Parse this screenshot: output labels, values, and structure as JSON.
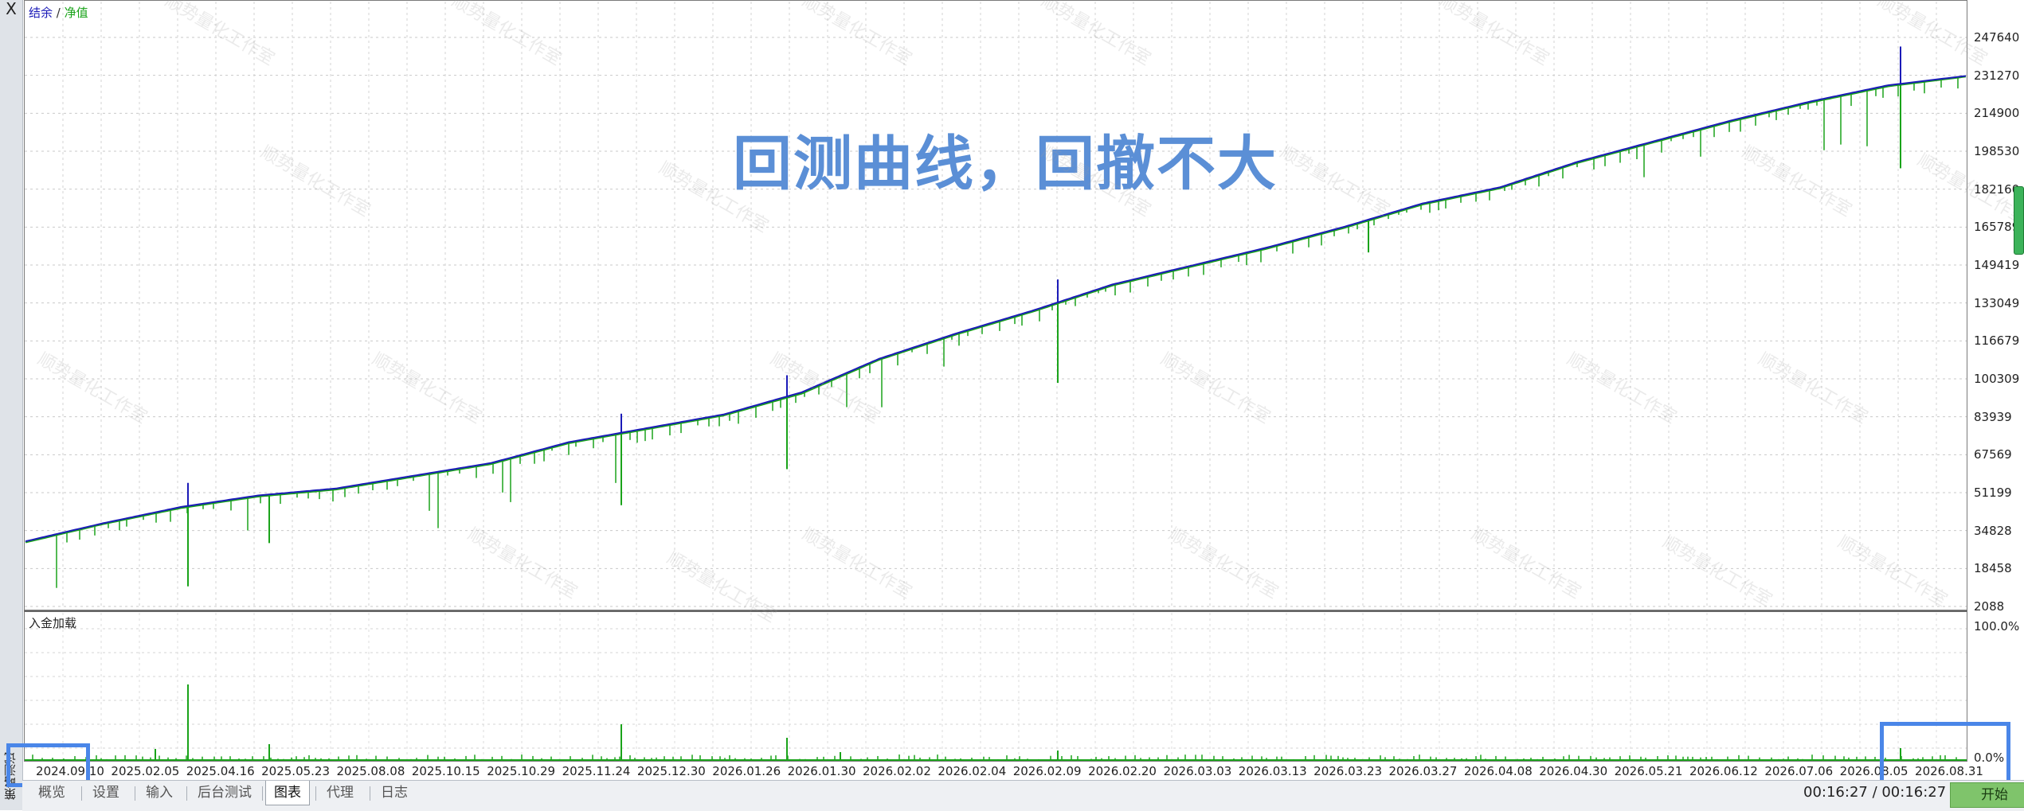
{
  "side_panel": {
    "close_glyph": "X",
    "label": "策略测试"
  },
  "legend": {
    "balance": "结余",
    "separator": "/",
    "equity": "净值"
  },
  "overlay_title": "回测曲线，回撤不大",
  "watermark_text": "顺势量化工作室",
  "sub_title": "入金加载",
  "y_axis_labels": [
    "247640",
    "231270",
    "214900",
    "198530",
    "182160",
    "165789",
    "149419",
    "133049",
    "116679",
    "100309",
    "83939",
    "67569",
    "51199",
    "34828",
    "18458",
    "2088"
  ],
  "sub_y_axis_labels": [
    "100.0%",
    "0.0%"
  ],
  "x_axis_labels": [
    "2024.09.10",
    "2025.02.05",
    "2025.04.16",
    "2025.05.23",
    "2025.08.08",
    "2025.10.15",
    "2025.10.29",
    "2025.11.24",
    "2025.12.30",
    "2026.01.26",
    "2026.01.30",
    "2026.02.02",
    "2026.02.04",
    "2026.02.09",
    "2026.02.20",
    "2026.03.03",
    "2026.03.13",
    "2026.03.23",
    "2026.03.27",
    "2026.04.08",
    "2026.04.30",
    "2026.05.21",
    "2026.06.12",
    "2026.07.06",
    "2026.08.05",
    "2026.08.31"
  ],
  "tabs": [
    {
      "label": "概览",
      "active": false
    },
    {
      "label": "设置",
      "active": false
    },
    {
      "label": "输入",
      "active": false
    },
    {
      "label": "后台测试",
      "active": false
    },
    {
      "label": "图表",
      "active": true
    },
    {
      "label": "代理",
      "active": false
    },
    {
      "label": "日志",
      "active": false
    }
  ],
  "timer": "00:16:27 / 00:16:27",
  "start_label": "开始",
  "colors": {
    "balance": "#1b1bb8",
    "equity": "#1aa31a",
    "highlight": "#4a86e8",
    "overlay": "#5b8fd6",
    "start": "#7fc46b"
  },
  "chart_data": {
    "type": "line",
    "y_range": [
      2088,
      247640
    ],
    "x_categories": [
      "2024.09.10",
      "2025.02.05",
      "2025.04.16",
      "2025.05.23",
      "2025.08.08",
      "2025.10.15",
      "2025.10.29",
      "2025.11.24",
      "2025.12.30",
      "2026.01.26",
      "2026.01.30",
      "2026.02.02",
      "2026.02.04",
      "2026.02.09",
      "2026.02.20",
      "2026.03.03",
      "2026.03.13",
      "2026.03.23",
      "2026.03.27",
      "2026.04.08",
      "2026.04.30",
      "2026.05.21",
      "2026.06.12",
      "2026.07.06",
      "2026.08.05",
      "2026.08.31"
    ],
    "series": [
      {
        "name": "结余",
        "values": [
          30200,
          38000,
          45000,
          50000,
          53000,
          58500,
          64000,
          73000,
          79000,
          85000,
          94500,
          109000,
          120000,
          130000,
          141000,
          149000,
          157000,
          166000,
          176000,
          183000,
          194000,
          203000,
          212000,
          220000,
          227000,
          231000
        ]
      },
      {
        "name": "净值",
        "values": [
          29800,
          37700,
          44600,
          49600,
          52600,
          58100,
          63600,
          72600,
          78600,
          84600,
          94000,
          108600,
          119600,
          129600,
          140600,
          148600,
          156600,
          165600,
          175600,
          182600,
          193600,
          202600,
          211600,
          219600,
          226600,
          230800
        ]
      }
    ],
    "sub_series": {
      "name": "入金加载",
      "y_range": [
        0,
        100
      ]
    }
  }
}
